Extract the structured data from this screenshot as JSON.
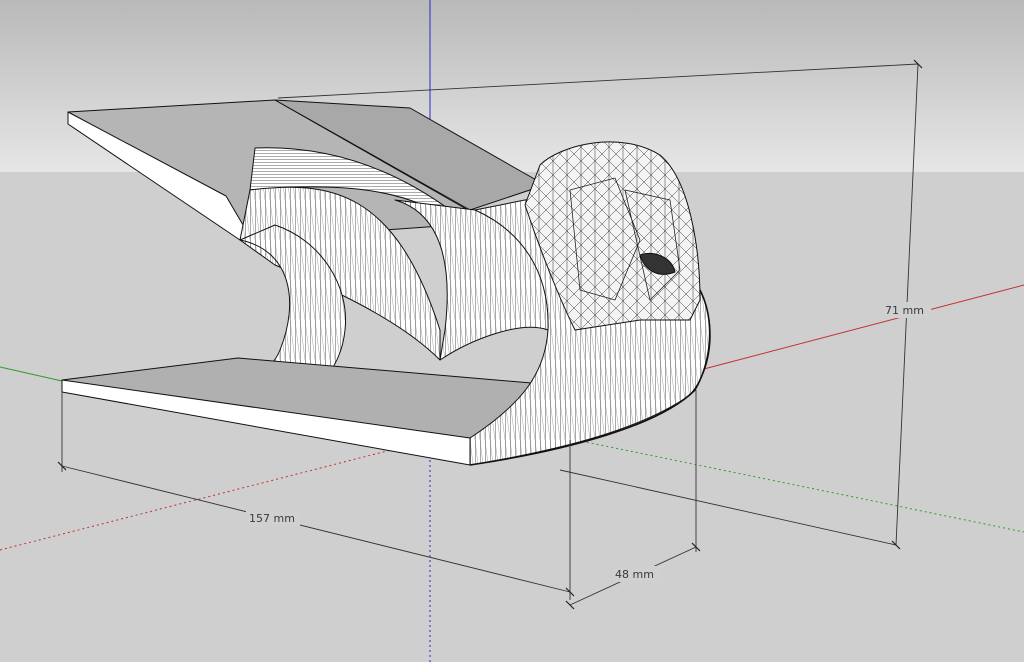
{
  "viewport": {
    "sky_color_top": "#b9b9b9",
    "sky_color_bottom": "#e6e6e6",
    "ground_color": "#cfcfcf",
    "model_face_color": "#ffffff",
    "model_top_color": "#b5b5b5",
    "edge_color": "#111111"
  },
  "axes": {
    "blue": "#2a2acc",
    "red": "#c23030",
    "green": "#2c9c2c"
  },
  "dimensions": {
    "length": "157 mm",
    "depth": "48 mm",
    "height": "71 mm"
  }
}
